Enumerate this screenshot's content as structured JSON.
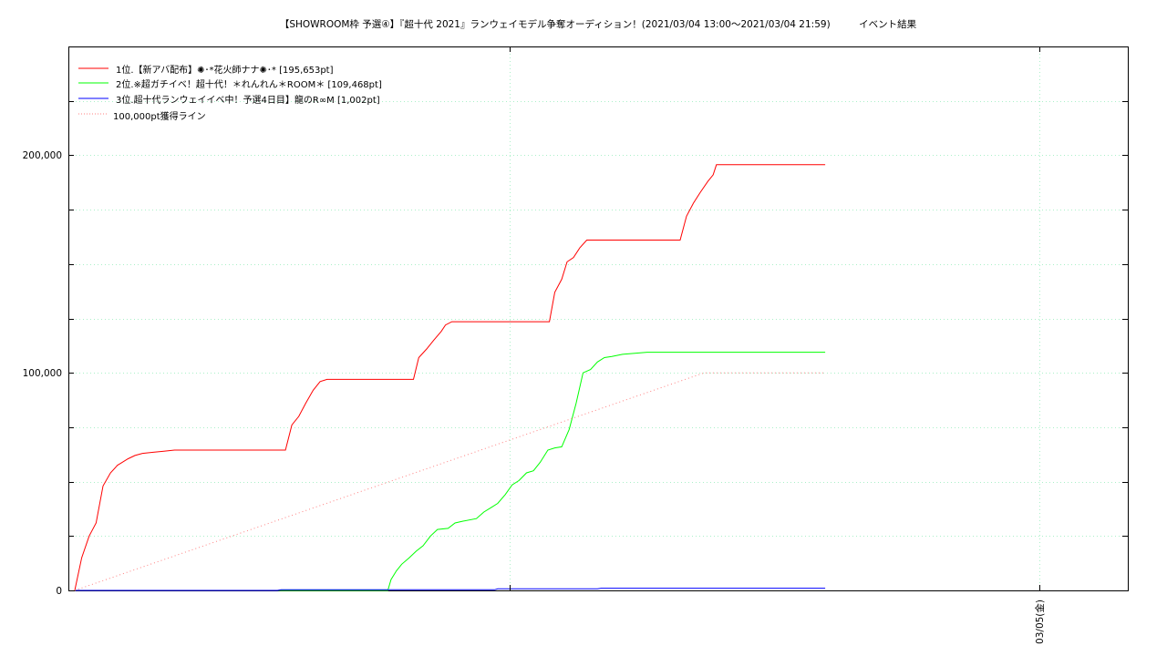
{
  "chart_data": {
    "type": "line",
    "title": "【SHOWROOM枠 予選④】『超十代 2021』ランウェイモデル争奪オーディション！(2021/03/04 13:00～2021/03/04 21:59)　　　イベント結果",
    "y_ticks": [
      "0",
      "100,000",
      "200,000"
    ],
    "x_ticks": [
      "03/05(金)"
    ],
    "ylim": [
      0,
      250000
    ],
    "grid": true,
    "legend_position": "top-left",
    "series": [
      {
        "name": "1位.【新アバ配布】✺･*花火師ナナ✺･* [195,653pt]",
        "color": "#ff0000",
        "points": [
          [
            0.0,
            0
          ],
          [
            0.13,
            15000
          ],
          [
            0.27,
            25000
          ],
          [
            0.4,
            31000
          ],
          [
            0.53,
            48000
          ],
          [
            0.67,
            54000
          ],
          [
            0.8,
            57500
          ],
          [
            1.0,
            60500
          ],
          [
            1.13,
            62000
          ],
          [
            1.27,
            63000
          ],
          [
            1.47,
            63500
          ],
          [
            1.67,
            64000
          ],
          [
            1.87,
            64500
          ],
          [
            2.2,
            64500
          ],
          [
            3.0,
            64500
          ],
          [
            3.95,
            64500
          ],
          [
            4.07,
            76000
          ],
          [
            4.2,
            80000
          ],
          [
            4.33,
            86000
          ],
          [
            4.47,
            92000
          ],
          [
            4.6,
            96000
          ],
          [
            4.73,
            97000
          ],
          [
            5.5,
            97000
          ],
          [
            6.35,
            97000
          ],
          [
            6.45,
            107000
          ],
          [
            6.6,
            111000
          ],
          [
            6.73,
            115000
          ],
          [
            6.87,
            119000
          ],
          [
            6.95,
            122000
          ],
          [
            7.07,
            123500
          ],
          [
            8.0,
            123500
          ],
          [
            8.9,
            123500
          ],
          [
            9.0,
            137000
          ],
          [
            9.13,
            143000
          ],
          [
            9.23,
            151000
          ],
          [
            9.35,
            153000
          ],
          [
            9.47,
            157500
          ],
          [
            9.6,
            161000
          ],
          [
            10.5,
            161000
          ],
          [
            11.35,
            161000
          ],
          [
            11.47,
            172000
          ],
          [
            11.6,
            178000
          ],
          [
            11.73,
            183000
          ],
          [
            11.87,
            188000
          ],
          [
            11.97,
            191000
          ],
          [
            12.03,
            195653
          ],
          [
            13.0,
            195653
          ],
          [
            14.07,
            195653
          ]
        ]
      },
      {
        "name": "2位.※超ガチイベ！超十代！＊れんれん＊ROOM＊ [109,468pt]",
        "color": "#00ff00",
        "points": [
          [
            0.0,
            0
          ],
          [
            5.0,
            0
          ],
          [
            5.87,
            0
          ],
          [
            5.93,
            5000
          ],
          [
            6.03,
            9000
          ],
          [
            6.13,
            12000
          ],
          [
            6.27,
            15000
          ],
          [
            6.4,
            18000
          ],
          [
            6.53,
            20500
          ],
          [
            6.67,
            25000
          ],
          [
            6.8,
            28000
          ],
          [
            7.0,
            28500
          ],
          [
            7.13,
            31000
          ],
          [
            7.27,
            31800
          ],
          [
            7.53,
            33000
          ],
          [
            7.67,
            36000
          ],
          [
            7.8,
            38000
          ],
          [
            7.93,
            40000
          ],
          [
            8.07,
            44000
          ],
          [
            8.2,
            48500
          ],
          [
            8.33,
            50500
          ],
          [
            8.47,
            54000
          ],
          [
            8.6,
            55000
          ],
          [
            8.73,
            59000
          ],
          [
            8.87,
            64500
          ],
          [
            9.0,
            65500
          ],
          [
            9.13,
            66000
          ],
          [
            9.27,
            74000
          ],
          [
            9.4,
            86000
          ],
          [
            9.53,
            100000
          ],
          [
            9.67,
            101500
          ],
          [
            9.8,
            105000
          ],
          [
            9.93,
            107000
          ],
          [
            10.07,
            107500
          ],
          [
            10.27,
            108500
          ],
          [
            10.5,
            109000
          ],
          [
            10.73,
            109468
          ],
          [
            12.0,
            109468
          ],
          [
            14.07,
            109468
          ]
        ]
      },
      {
        "name": "3位.超十代ランウェイイベ中！予選4日目】龍のR∞M [1,002pt]",
        "color": "#0000ff",
        "points": [
          [
            0.0,
            0
          ],
          [
            3.8,
            0
          ],
          [
            3.87,
            300
          ],
          [
            5.0,
            300
          ],
          [
            7.87,
            300
          ],
          [
            7.93,
            700
          ],
          [
            9.8,
            700
          ],
          [
            9.87,
            1002
          ],
          [
            12.0,
            1002
          ],
          [
            14.07,
            1002
          ]
        ]
      },
      {
        "name": "100,000pt獲得ライン",
        "color": "#ff8080",
        "dashed": true,
        "points": [
          [
            0.0,
            0
          ],
          [
            11.8,
            100000
          ],
          [
            14.07,
            100000
          ]
        ]
      }
    ]
  }
}
